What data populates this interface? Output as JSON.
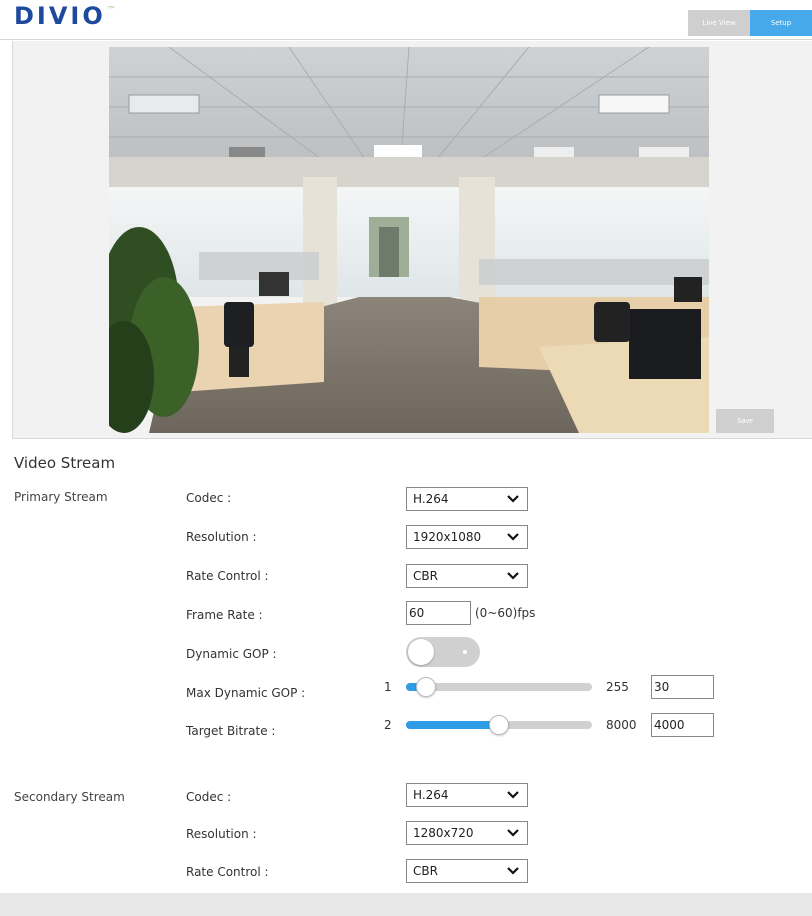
{
  "header": {
    "logo_text": "DIVIO",
    "logo_mark": "ᵀᴹ",
    "tabs": [
      {
        "label": "Live View",
        "active": false
      },
      {
        "label": "Setup",
        "active": true
      }
    ]
  },
  "video": {
    "save_label": "Save"
  },
  "settings": {
    "title": "Video Stream",
    "primary": {
      "label": "Primary Stream",
      "codec_label": "Codec :",
      "codec_value": "H.264",
      "resolution_label": "Resolution :",
      "resolution_value": "1920x1080",
      "rate_control_label": "Rate Control :",
      "rate_control_value": "CBR",
      "frame_rate_label": "Frame Rate :",
      "frame_rate_value": "60",
      "frame_rate_unit": "(0~60)fps",
      "dynamic_gop_label": "Dynamic GOP :",
      "dynamic_gop_on": false,
      "max_gop_label": "Max Dynamic GOP :",
      "max_gop_min": "1",
      "max_gop_max": "255",
      "max_gop_value": "30",
      "bitrate_label": "Target Bitrate :",
      "bitrate_min": "2",
      "bitrate_max": "8000",
      "bitrate_value": "4000"
    },
    "secondary": {
      "label": "Secondary Stream",
      "codec_label": "Codec :",
      "codec_value": "H.264",
      "resolution_label": "Resolution :",
      "resolution_value": "1280x720",
      "rate_control_label": "Rate Control :",
      "rate_control_value": "CBR"
    }
  },
  "colors": {
    "accent": "#2e9de6",
    "tab_active": "#45a9ea",
    "tab_inactive": "#cfcfcf",
    "logo": "#1e4a9e"
  },
  "icons": {
    "select_arrow": "chevron-down-icon"
  }
}
